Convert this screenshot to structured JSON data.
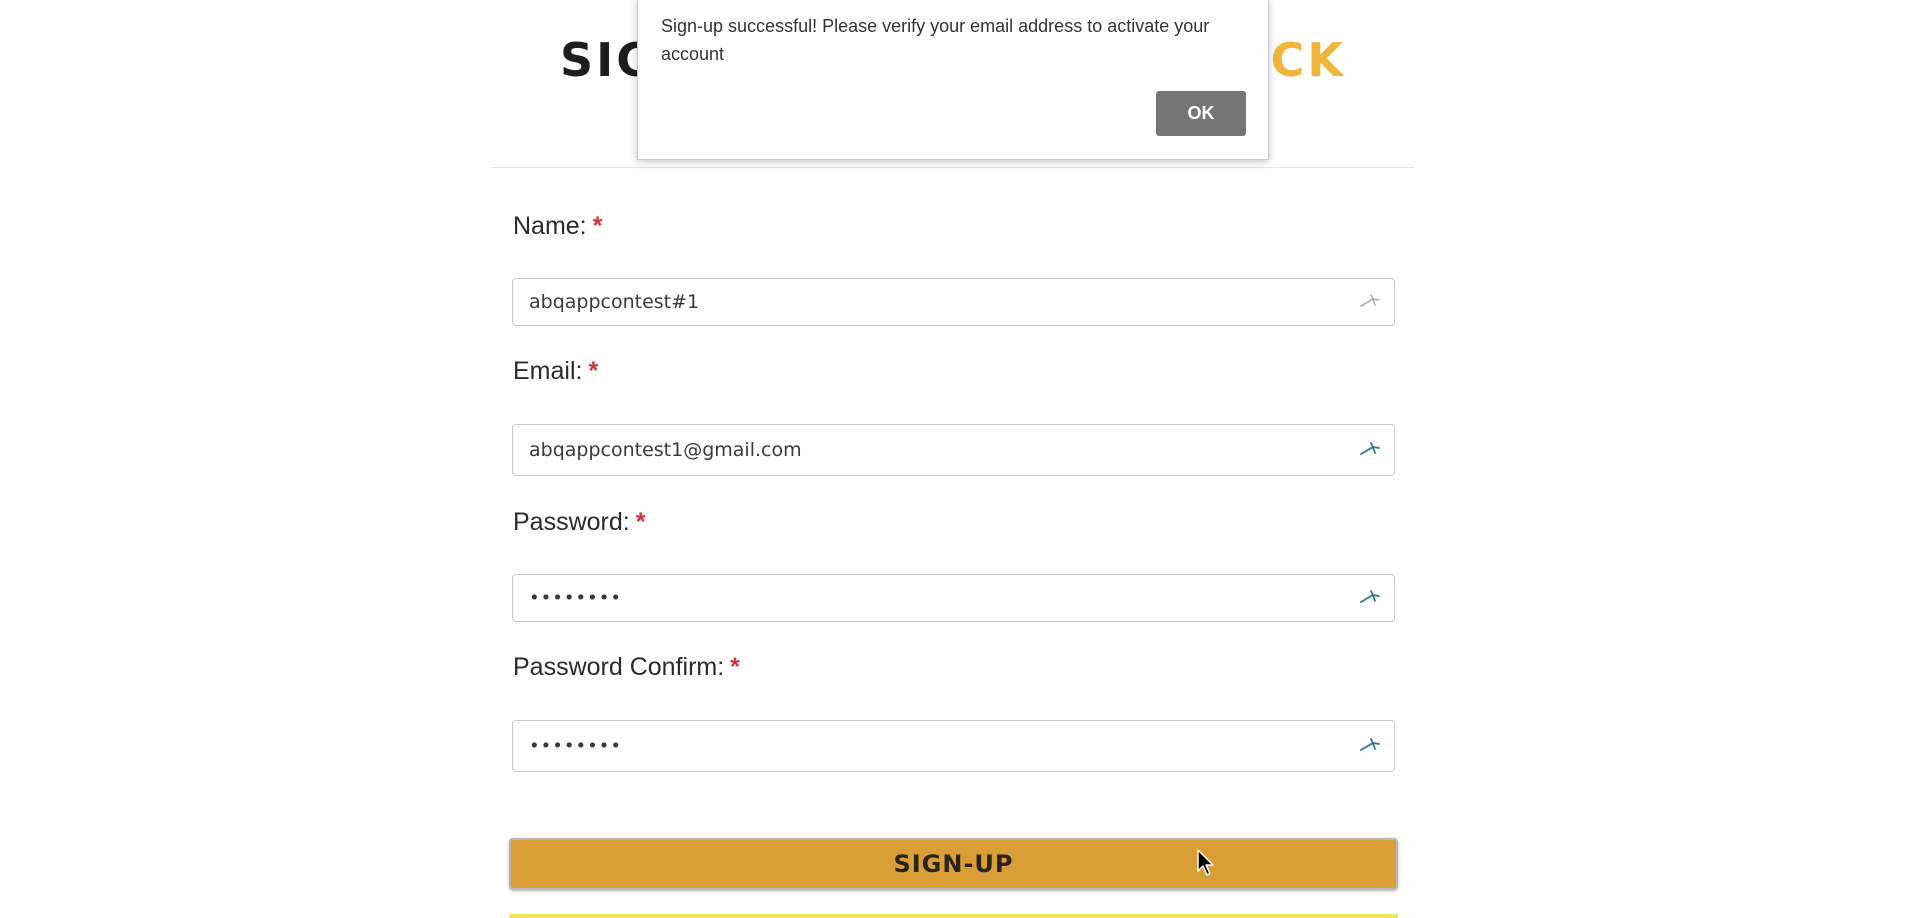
{
  "header": {
    "title_left": "SIG",
    "title_right": "UCK"
  },
  "form": {
    "name": {
      "label": "Name:",
      "required_mark": "*",
      "value": "abqappcontest#1"
    },
    "email": {
      "label": "Email:",
      "required_mark": "*",
      "value": "abqappcontest1@gmail.com"
    },
    "password": {
      "label": "Password:",
      "required_mark": "*",
      "value": "••••••••"
    },
    "password_confirm": {
      "label": "Password Confirm:",
      "required_mark": "*",
      "value": "••••••••"
    },
    "submit_label": "SIGN-UP"
  },
  "dialog": {
    "message": "Sign-up successful! Please verify your email address to activate your account",
    "ok_label": "OK"
  },
  "colors": {
    "accent": "#d99e36",
    "brand_yellow": "#f0b63b",
    "required": "#d32f3d",
    "ok_button": "#757575"
  },
  "icons": {
    "field_icon": "key-icon",
    "cursor": "mouse-pointer-icon"
  }
}
